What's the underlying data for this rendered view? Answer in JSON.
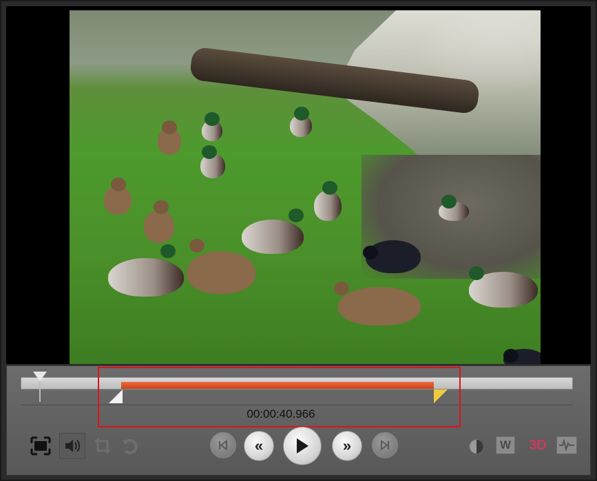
{
  "timeline": {
    "timecode": "00:00:40.966"
  },
  "controls": {
    "left_tools": [
      {
        "name": "fit-to-screen",
        "icon": "fullscreen-icon"
      },
      {
        "name": "volume",
        "icon": "speaker-icon"
      },
      {
        "name": "crop",
        "icon": "crop-icon"
      },
      {
        "name": "rotate",
        "icon": "rotate-icon"
      }
    ],
    "transport": [
      {
        "name": "previous",
        "label": "|<"
      },
      {
        "name": "rewind",
        "label": "«"
      },
      {
        "name": "play",
        "label": "▶"
      },
      {
        "name": "fast-forward",
        "label": "»"
      },
      {
        "name": "next",
        "label": ">|"
      }
    ],
    "right_tools": [
      {
        "name": "contrast",
        "icon": "contrast-icon"
      },
      {
        "name": "watermark",
        "label": "W"
      },
      {
        "name": "3d",
        "label": "3D"
      },
      {
        "name": "waveform",
        "icon": "waveform-icon"
      }
    ]
  },
  "colors": {
    "selection": "#d84a1f",
    "highlight_border": "#e0121a",
    "mark_out": "#f2c93d",
    "accent_3d": "#cc3a5a"
  }
}
